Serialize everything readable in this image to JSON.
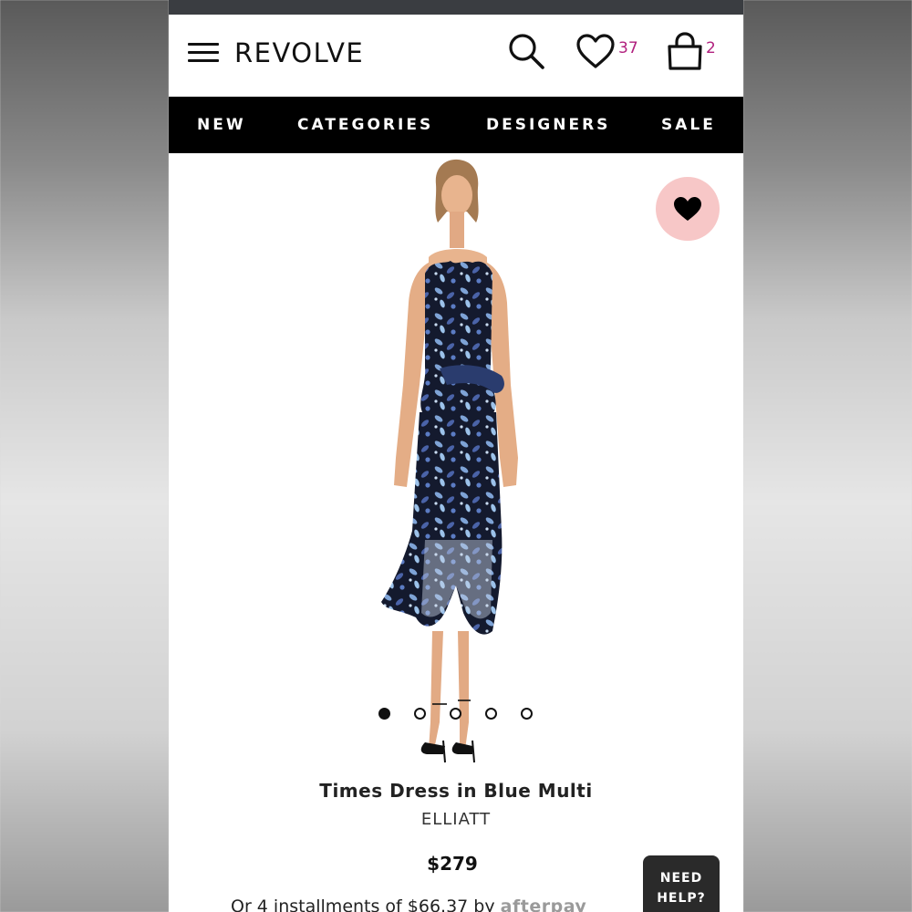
{
  "header": {
    "logo": "REVOLVE",
    "wishlist_count": "37",
    "bag_count": "2",
    "accent_color": "#b1207e"
  },
  "nav": {
    "items": [
      {
        "label": "NEW"
      },
      {
        "label": "CATEGORIES"
      },
      {
        "label": "DESIGNERS"
      },
      {
        "label": "SALE"
      }
    ]
  },
  "gallery": {
    "image_count": 5,
    "active_index": 0
  },
  "product": {
    "title": "Times Dress in Blue Multi",
    "brand": "ELLIATT",
    "price": "$279",
    "installments_text": "Or 4 installments of $66.37 by",
    "installments_provider": "afterpay"
  },
  "help": {
    "line1": "NEED",
    "line2": "HELP?"
  },
  "colors": {
    "fav_button_bg": "#f7c7c7",
    "nav_bg": "#000000"
  }
}
